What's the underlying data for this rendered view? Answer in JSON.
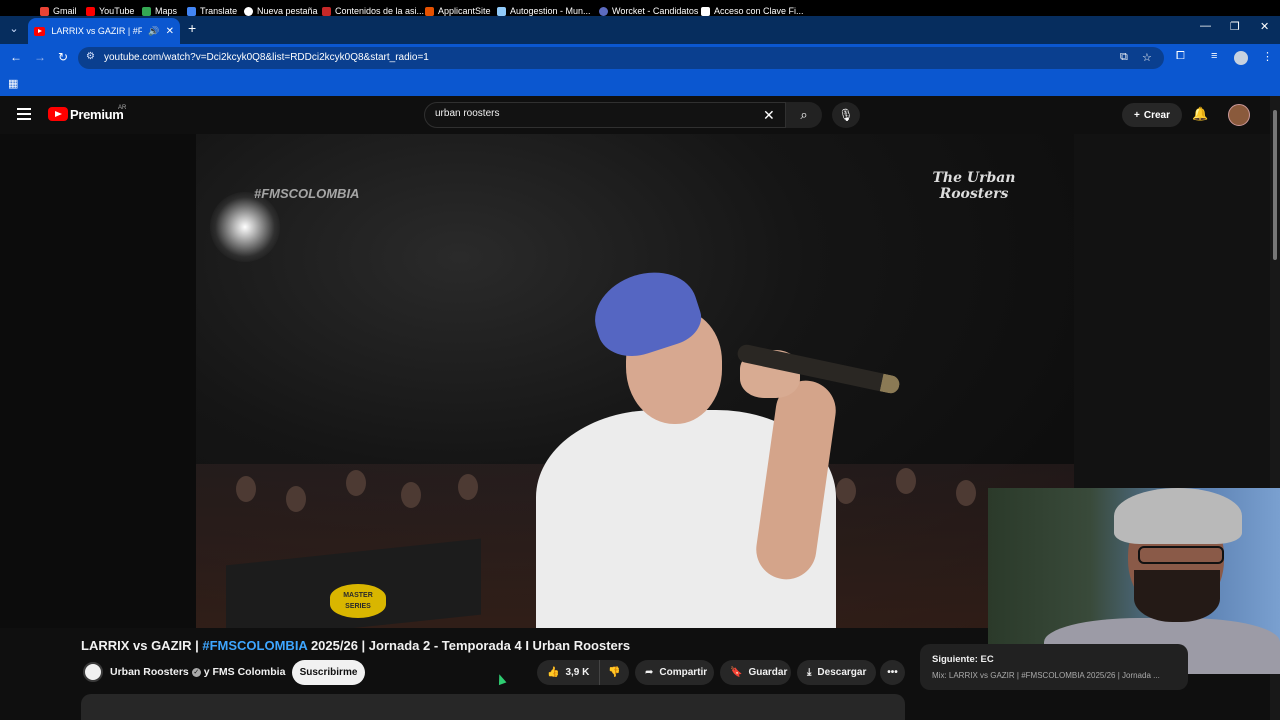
{
  "browser": {
    "tab_title": "LARRIX vs GAZIR | #FMSCO",
    "url": "youtube.com/watch?v=Dci2kcyk0Q8&list=RDDci2kcyk0Q8&start_radio=1",
    "bookmarks": [
      {
        "label": "Gmail",
        "color": "#ea4335"
      },
      {
        "label": "YouTube",
        "color": "#ff0000"
      },
      {
        "label": "Maps",
        "color": "#34a853"
      },
      {
        "label": "Translate",
        "color": "#4285f4"
      },
      {
        "label": "Nueva pestaña",
        "color": "#ffffff"
      },
      {
        "label": "Contenidos de la asi...",
        "color": "#c62828"
      },
      {
        "label": "ApplicantSite",
        "color": "#e65100"
      },
      {
        "label": "Autogestion - Mun...",
        "color": "#90caf9"
      },
      {
        "label": "Worcket - Candidatos",
        "color": "#5c6bc0"
      },
      {
        "label": "Acceso con Clave Fi...",
        "color": "#ffffff"
      }
    ]
  },
  "youtube": {
    "brand": "Premium",
    "region": "AR",
    "search_value": "urban roosters",
    "create_label": "Crear"
  },
  "video_overlay": {
    "hashtag_watermark": "#FMSCOLOMBIA",
    "logo_text": "The Urban Roosters",
    "badge_text": "MASTER SERIES"
  },
  "video": {
    "title_prefix": "LARRIX vs GAZIR | ",
    "title_hashtag": "#FMSCOLOMBIA",
    "title_suffix": " 2025/26 | Jornada 2 - Temporada 4 I Urban Roosters",
    "channel_name": "Urban Roosters",
    "channel_collab": "y FMS Colombia",
    "subscribe_label": "Suscribirme",
    "likes": "3,9 K",
    "share_label": "Compartir",
    "save_label": "Guardar",
    "download_label": "Descargar"
  },
  "up_next": {
    "label": "Siguiente: EC",
    "subtitle": "Mix: LARRIX vs GAZIR | #FMSCOLOMBIA 2025/26 | Jornada ..."
  }
}
